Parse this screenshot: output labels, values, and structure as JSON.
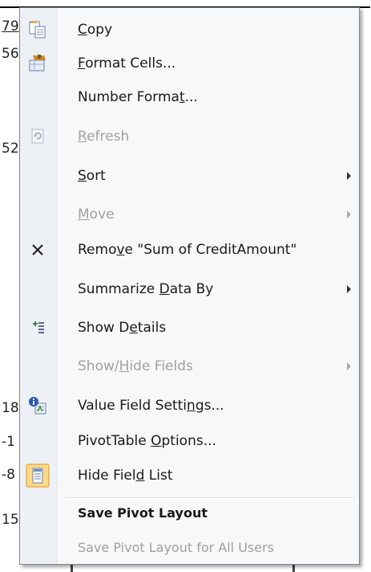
{
  "sheet": {
    "cells": [
      "79",
      "56",
      "52",
      "18",
      "-1",
      "-8",
      "15"
    ]
  },
  "menu": {
    "items": [
      {
        "key": "copy",
        "label": "Copy",
        "mnemonic_index": 0,
        "disabled": false,
        "submenu": false,
        "icon": "copy-icon"
      },
      {
        "key": "format-cells",
        "label": "Format Cells...",
        "mnemonic_index": 0,
        "disabled": false,
        "submenu": false,
        "icon": "format-cells-icon"
      },
      {
        "key": "number-format",
        "label": "Number Format...",
        "mnemonic_index": 12,
        "disabled": false,
        "submenu": false,
        "icon": ""
      },
      {
        "key": "refresh",
        "label": "Refresh",
        "mnemonic_index": 0,
        "disabled": true,
        "submenu": false,
        "icon": "refresh-icon"
      },
      {
        "key": "sort",
        "label": "Sort",
        "mnemonic_index": 0,
        "disabled": false,
        "submenu": true,
        "icon": ""
      },
      {
        "key": "move",
        "label": "Move",
        "mnemonic_index": 0,
        "disabled": true,
        "submenu": true,
        "icon": ""
      },
      {
        "key": "remove",
        "label": "Remove \"Sum of CreditAmount\"",
        "mnemonic_index": 4,
        "disabled": false,
        "submenu": false,
        "icon": "remove-icon"
      },
      {
        "key": "summarize",
        "label": "Summarize Data By",
        "mnemonic_index": 10,
        "disabled": false,
        "submenu": true,
        "icon": ""
      },
      {
        "key": "show-details",
        "label": "Show Details",
        "mnemonic_index": 6,
        "disabled": false,
        "submenu": false,
        "icon": "show-details-icon"
      },
      {
        "key": "show-hide-fields",
        "label": "Show/Hide Fields",
        "mnemonic_index": 5,
        "disabled": true,
        "submenu": true,
        "icon": ""
      },
      {
        "key": "value-field-settings",
        "label": "Value Field Settings...",
        "mnemonic_index": 17,
        "disabled": false,
        "submenu": false,
        "icon": "value-field-settings-icon"
      },
      {
        "key": "pivottable-options",
        "label": "PivotTable Options...",
        "mnemonic_index": 11,
        "disabled": false,
        "submenu": false,
        "icon": ""
      },
      {
        "key": "hide-field-list",
        "label": "Hide Field List",
        "mnemonic_index": 9,
        "disabled": false,
        "submenu": false,
        "icon": "field-list-icon"
      },
      {
        "key": "save-pivot-layout",
        "label": "Save Pivot Layout",
        "mnemonic_index": -1,
        "disabled": false,
        "submenu": false,
        "icon": ""
      },
      {
        "key": "save-pivot-layout-all",
        "label": "Save Pivot Layout for All Users",
        "mnemonic_index": -1,
        "disabled": true,
        "submenu": false,
        "icon": ""
      }
    ]
  }
}
